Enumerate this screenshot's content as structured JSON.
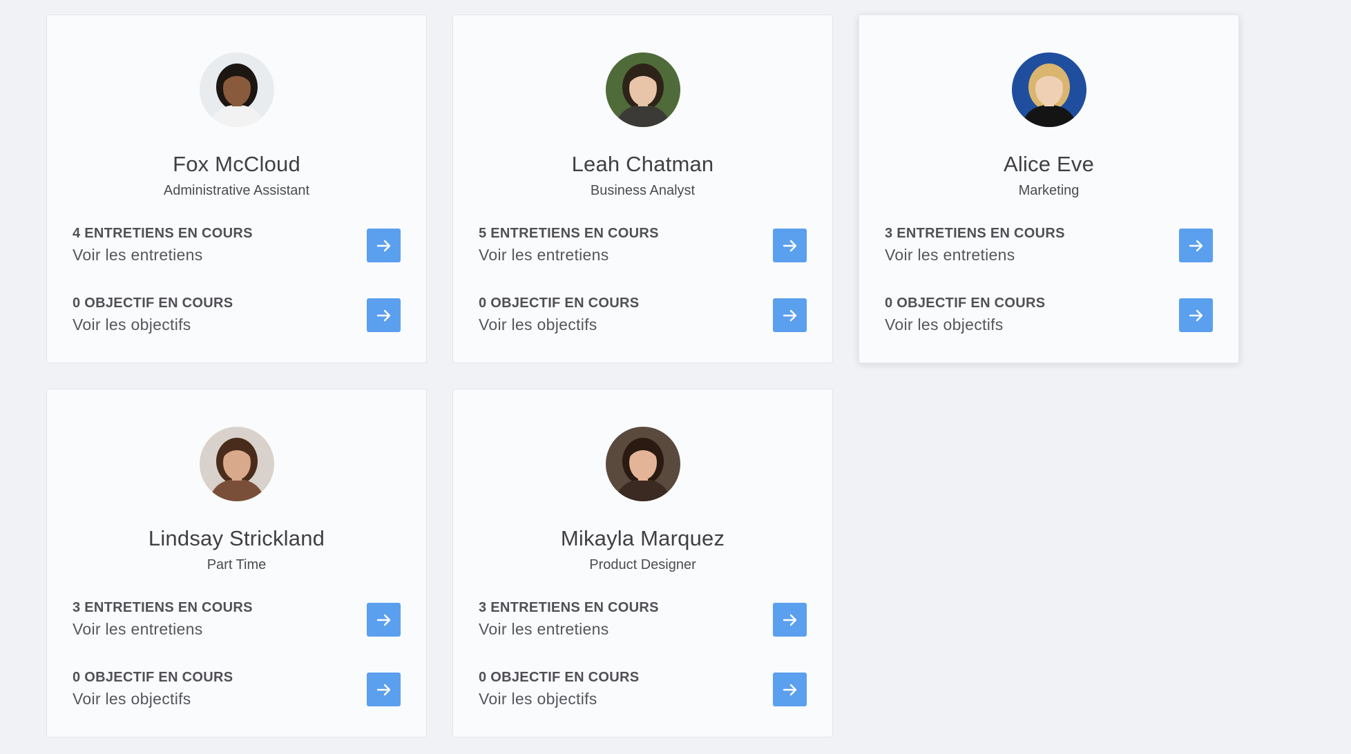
{
  "people": [
    {
      "name": "Fox McCloud",
      "role": "Administrative Assistant",
      "interviews_count": "4 ENTRETIENS EN COURS",
      "interviews_link": "Voir les entretiens",
      "objectives_count": "0 OBJECTIF EN COURS",
      "objectives_link": "Voir les objectifs",
      "avatar": {
        "bg": "#e9ecef",
        "hair": "#1c1712",
        "skin": "#8a5a3c",
        "shirt": "#f2f2f2"
      }
    },
    {
      "name": "Leah Chatman",
      "role": "Business Analyst",
      "interviews_count": "5 ENTRETIENS EN COURS",
      "interviews_link": "Voir les entretiens",
      "objectives_count": "0 OBJECTIF EN COURS",
      "objectives_link": "Voir les objectifs",
      "avatar": {
        "bg": "#4f6b3a",
        "hair": "#2e2319",
        "skin": "#e8c4a8",
        "shirt": "#3c3a36"
      }
    },
    {
      "name": "Alice Eve",
      "role": "Marketing",
      "interviews_count": "3 ENTRETIENS EN COURS",
      "interviews_link": "Voir les entretiens",
      "objectives_count": "0 OBJECTIF EN COURS",
      "objectives_link": "Voir les objectifs",
      "avatar": {
        "bg": "#1f4e9e",
        "hair": "#d9b56e",
        "skin": "#efd0b5",
        "shirt": "#141414"
      }
    },
    {
      "name": "Lindsay Strickland",
      "role": "Part Time",
      "interviews_count": "3 ENTRETIENS EN COURS",
      "interviews_link": "Voir les entretiens",
      "objectives_count": "0 OBJECTIF EN COURS",
      "objectives_link": "Voir les objectifs",
      "avatar": {
        "bg": "#d9d2cc",
        "hair": "#4a2c1c",
        "skin": "#d9a98b",
        "shirt": "#7a4f3a"
      }
    },
    {
      "name": "Mikayla Marquez",
      "role": "Product Designer",
      "interviews_count": "3 ENTRETIENS EN COURS",
      "interviews_link": "Voir les entretiens",
      "objectives_count": "0 OBJECTIF EN COURS",
      "objectives_link": "Voir les objectifs",
      "avatar": {
        "bg": "#5a4a3e",
        "hair": "#2a1a12",
        "skin": "#e3b497",
        "shirt": "#3a2a22"
      }
    }
  ],
  "colors": {
    "page_background": "#f1f2f5",
    "card_background": "#fafbfc",
    "accent_button": "#5b9fef"
  },
  "icons": {
    "arrow_button": "arrow-right-icon"
  }
}
